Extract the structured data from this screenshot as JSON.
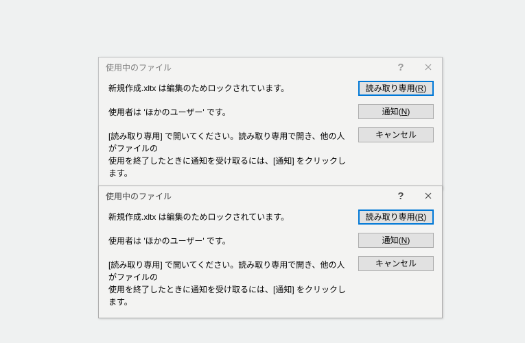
{
  "dialogs": [
    {
      "title": "使用中のファイル",
      "message1": "新規作成.xltx は編集のためロックされています。",
      "message2": "使用者は 'ほかのユーザー' です。",
      "message3a": "[読み取り専用] で開いてください。読み取り専用で開き、他の人がファイルの",
      "message3b": "使用を終了したときに通知を受け取るには、[通知] をクリックします。",
      "buttons": {
        "readonly_label": "読み取り専用(",
        "readonly_accel": "R",
        "readonly_tail": ")",
        "notify_label": "通知(",
        "notify_accel": "N",
        "notify_tail": ")",
        "cancel_label": "キャンセル"
      }
    },
    {
      "title": "使用中のファイル",
      "message1": "新規作成.xltx は編集のためロックされています。",
      "message2": "使用者は 'ほかのユーザー' です。",
      "message3a": "[読み取り専用] で開いてください。読み取り専用で開き、他の人がファイルの",
      "message3b": "使用を終了したときに通知を受け取るには、[通知] をクリックします。",
      "buttons": {
        "readonly_label": "読み取り専用(",
        "readonly_accel": "R",
        "readonly_tail": ")",
        "notify_label": "通知(",
        "notify_accel": "N",
        "notify_tail": ")",
        "cancel_label": "キャンセル"
      }
    }
  ],
  "icons": {
    "help": "?",
    "close": "close-icon"
  }
}
